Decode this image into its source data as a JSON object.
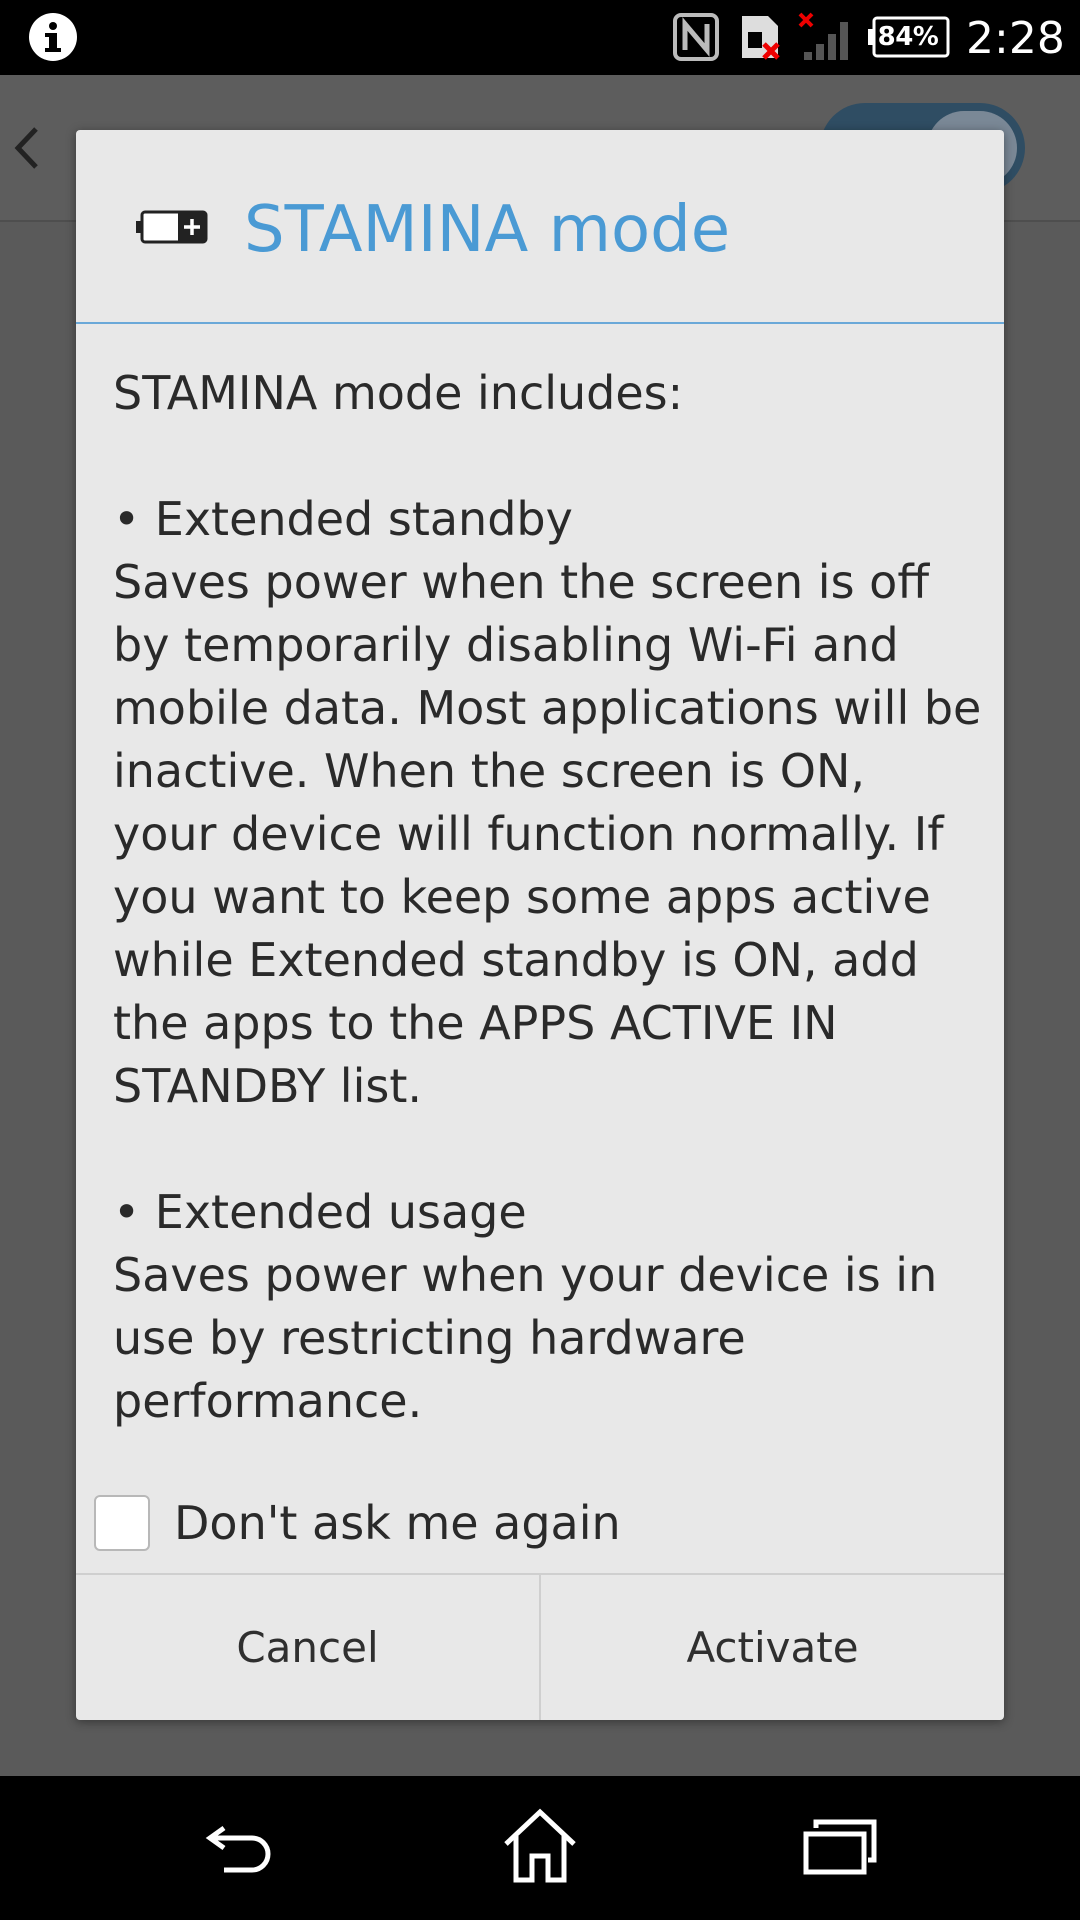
{
  "status_bar": {
    "battery_percent": "84%",
    "time": "2:28",
    "icons": [
      "info-icon",
      "nfc-icon",
      "sim-error-icon",
      "signal-no-service-icon",
      "battery-icon"
    ]
  },
  "dialog": {
    "title": "STAMINA mode",
    "icon": "battery-plus-icon",
    "message": "STAMINA mode includes:\n\n• Extended standby\nSaves power when the screen is off by temporarily disabling Wi-Fi and mobile data. Most applications will be inactive. When the screen is ON, your device will function normally. If you want to keep some apps active while Extended standby is ON, add the apps to the APPS ACTIVE IN STANDBY list.\n\n• Extended usage\nSaves power when your device is in use by restricting hardware performance.",
    "checkbox_label": "Don't ask me again",
    "checkbox_checked": false,
    "cancel_label": "Cancel",
    "activate_label": "Activate",
    "accent_color": "#4a9ad4"
  },
  "nav_bar": {
    "icons": [
      "back-icon",
      "home-icon",
      "recent-apps-icon"
    ]
  }
}
